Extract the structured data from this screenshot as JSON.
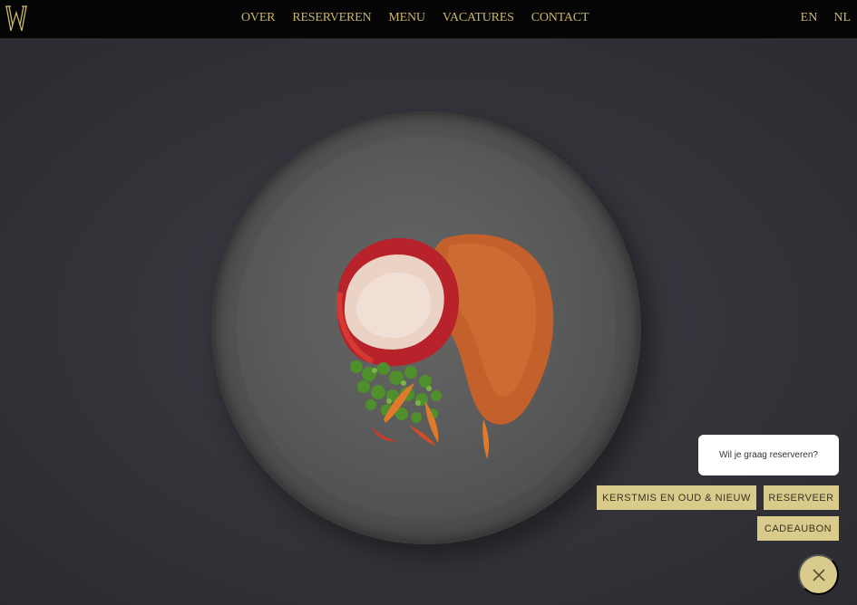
{
  "header": {
    "logo_icon": "w-monogram-logo",
    "nav": [
      {
        "label": "OVER"
      },
      {
        "label": "RESERVEREN"
      },
      {
        "label": "MENU"
      },
      {
        "label": "VACATURES"
      },
      {
        "label": "CONTACT"
      }
    ],
    "languages": [
      "EN",
      "NL"
    ]
  },
  "hero": {
    "image": "plated-lobster-dish-photo"
  },
  "widget": {
    "prompt": "Wil je graag reserveren?",
    "buttons": {
      "kerst": "KERSTMIS EN OUD & NIEUW",
      "reserveer": "RESERVEER",
      "cadeau": "CADEAUBON"
    },
    "close_icon": "close-icon"
  },
  "colors": {
    "header_bg": "#050505",
    "gold": "#c9b56e",
    "cta_bg": "#d8cb8c",
    "hero_bg": "#34343b"
  }
}
